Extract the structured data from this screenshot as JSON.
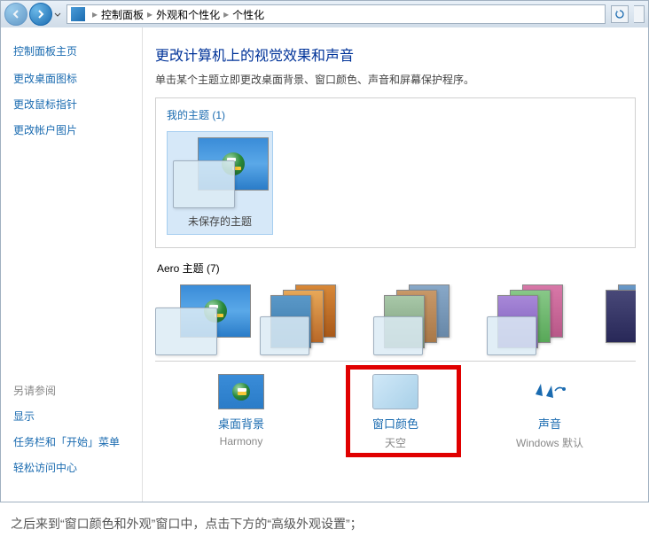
{
  "titlebar": {
    "breadcrumb": [
      "控制面板",
      "外观和个性化",
      "个性化"
    ]
  },
  "sidebar": {
    "title": "控制面板主页",
    "links": [
      "更改桌面图标",
      "更改鼠标指针",
      "更改帐户图片"
    ],
    "seealso_title": "另请参阅",
    "seealso": [
      "显示",
      "任务栏和「开始」菜单",
      "轻松访问中心"
    ]
  },
  "main": {
    "heading": "更改计算机上的视觉效果和声音",
    "desc": "单击某个主题立即更改桌面背景、窗口颜色、声音和屏幕保护程序。"
  },
  "mythemes": {
    "title": "我的主题 (1)",
    "items": [
      {
        "label": "未保存的主题",
        "selected": true
      }
    ]
  },
  "aero": {
    "title": "Aero 主题 (7)"
  },
  "bottom": [
    {
      "key": "bg",
      "label": "桌面背景",
      "sub": "Harmony"
    },
    {
      "key": "color",
      "label": "窗口颜色",
      "sub": "天空"
    },
    {
      "key": "sound",
      "label": "声音",
      "sub": "Windows 默认"
    }
  ],
  "caption": "之后来到“窗口颜色和外观”窗口中，点击下方的“高级外观设置”；"
}
